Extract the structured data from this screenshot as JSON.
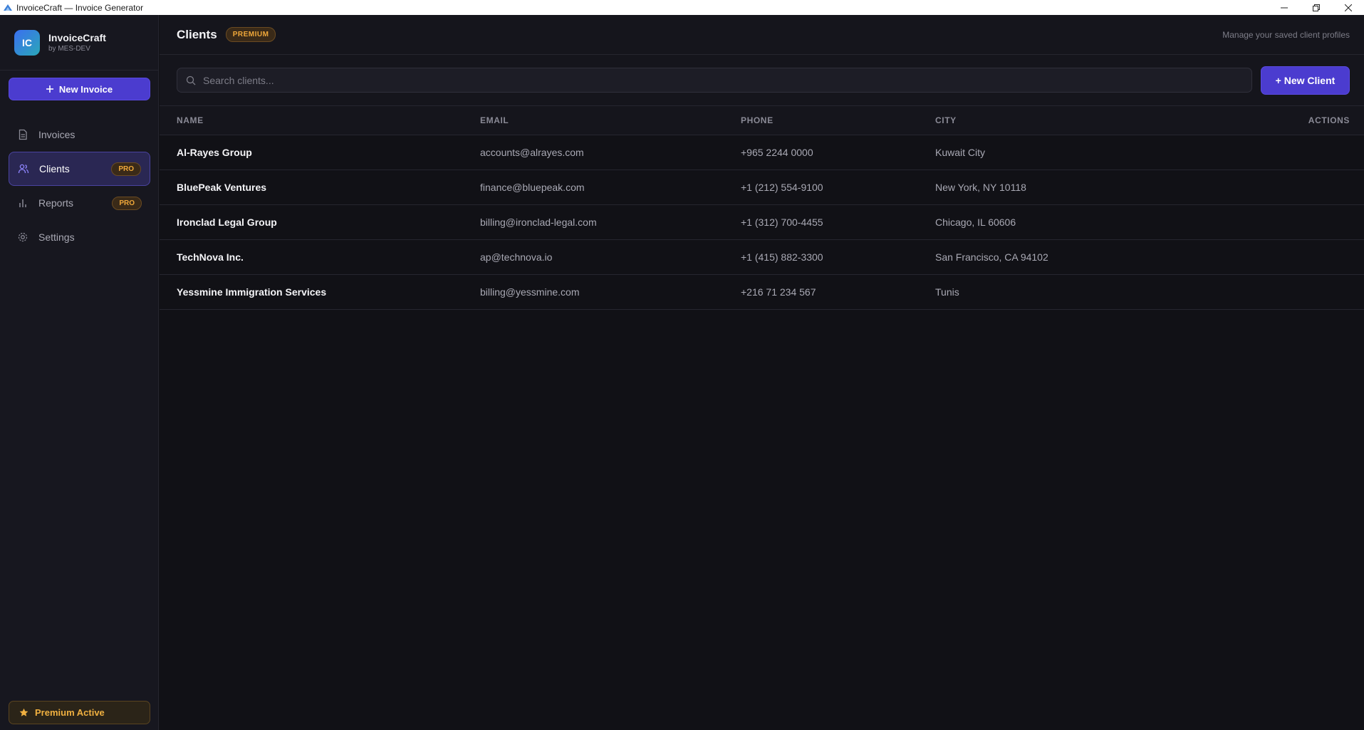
{
  "window": {
    "title": "InvoiceCraft — Invoice Generator"
  },
  "sidebar": {
    "brand": {
      "logo_initials": "IC",
      "name": "InvoiceCraft",
      "subtitle": "by MES-DEV"
    },
    "new_invoice_label": "New Invoice",
    "items": [
      {
        "label": "Invoices",
        "icon": "document-icon",
        "badge": ""
      },
      {
        "label": "Clients",
        "icon": "users-icon",
        "badge": "PRO",
        "active": true
      },
      {
        "label": "Reports",
        "icon": "bar-chart-icon",
        "badge": "PRO"
      },
      {
        "label": "Settings",
        "icon": "gear-icon",
        "badge": ""
      }
    ],
    "premium_label": "Premium Active"
  },
  "header": {
    "title": "Clients",
    "badge": "PREMIUM",
    "description": "Manage your saved client profiles"
  },
  "toolbar": {
    "search_placeholder": "Search clients...",
    "new_client_label": "+ New Client"
  },
  "table": {
    "columns": {
      "name": "NAME",
      "email": "EMAIL",
      "phone": "PHONE",
      "city": "CITY",
      "actions": "ACTIONS"
    },
    "rows": [
      {
        "name": "Al-Rayes Group",
        "email": "accounts@alrayes.com",
        "phone": "+965 2244 0000",
        "city": "Kuwait City"
      },
      {
        "name": "BluePeak Ventures",
        "email": "finance@bluepeak.com",
        "phone": "+1 (212) 554-9100",
        "city": "New York, NY 10118"
      },
      {
        "name": "Ironclad Legal Group",
        "email": "billing@ironclad-legal.com",
        "phone": "+1 (312) 700-4455",
        "city": "Chicago, IL 60606"
      },
      {
        "name": "TechNova Inc.",
        "email": "ap@technova.io",
        "phone": "+1 (415) 882-3300",
        "city": "San Francisco, CA 94102"
      },
      {
        "name": "Yessmine Immigration Services",
        "email": "billing@yessmine.com",
        "phone": "+216 71 234 567",
        "city": "Tunis"
      }
    ]
  },
  "colors": {
    "accent": "#4b3ccf",
    "premium": "#f0a83a",
    "background": "#111116"
  }
}
